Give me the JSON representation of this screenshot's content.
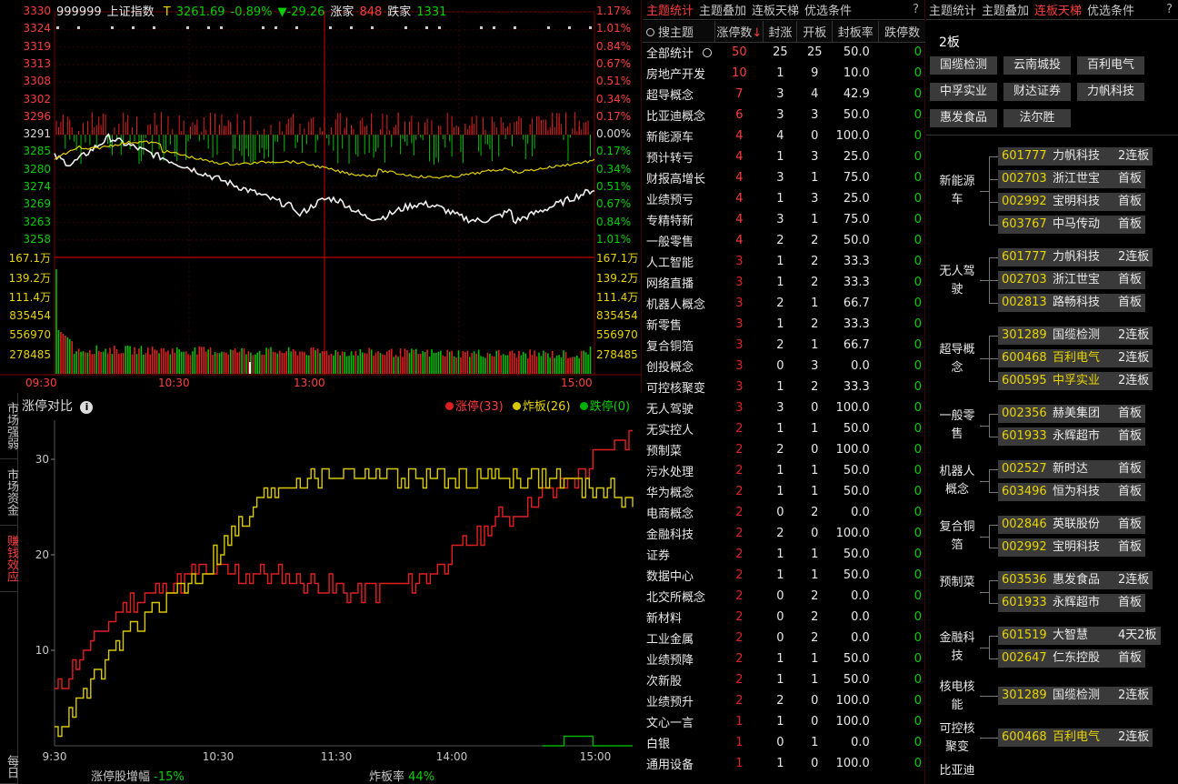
{
  "index": {
    "code": "999999",
    "name": "上证指数",
    "mark": "T",
    "price": "3261.69",
    "change_pct": "-0.89%",
    "change": "▼-29.26",
    "up_label": "涨家",
    "up_count": "848",
    "down_label": "跌家",
    "down_count": "1331"
  },
  "price_axis_left": [
    "3330",
    "3324",
    "3319",
    "3313",
    "3308",
    "3302",
    "3296",
    "3291",
    "3285",
    "3280",
    "3274",
    "3269",
    "3263",
    "3258"
  ],
  "price_axis_right": [
    "1.17%",
    "1.01%",
    "0.84%",
    "0.67%",
    "0.51%",
    "0.34%",
    "0.17%",
    "0.00%",
    "0.17%",
    "0.34%",
    "0.51%",
    "0.67%",
    "0.84%",
    "1.01%"
  ],
  "volume_axis": [
    "167.1万",
    "139.2万",
    "111.4万",
    "835454",
    "556970",
    "278485"
  ],
  "time_axis": [
    "09:30",
    "10:30",
    "13:00",
    "15:00"
  ],
  "side_tabs": [
    "市场强弱",
    "市场资金",
    "赚钱效应",
    "每日"
  ],
  "compare": {
    "title": "涨停对比",
    "legend": [
      {
        "label": "涨停(33)",
        "color": "#e02020"
      },
      {
        "label": "炸板(26)",
        "color": "#d8c800"
      },
      {
        "label": "跌停(0)",
        "color": "#00b000"
      }
    ],
    "y_ticks": [
      "30",
      "20",
      "10"
    ],
    "x_ticks": [
      "9:30",
      "10:30",
      "11:30",
      "14:00",
      "15:00"
    ],
    "footer_left_label": "涨停股增幅",
    "footer_left_value": "-15%",
    "footer_right_label": "炸板率",
    "footer_right_value": "44%"
  },
  "chart_data": {
    "type": "line",
    "title": "涨停对比",
    "xlabel": "",
    "ylabel": "",
    "x": [
      "9:30",
      "10:00",
      "10:30",
      "11:00",
      "11:30",
      "13:30",
      "14:00",
      "14:30",
      "15:00"
    ],
    "series": [
      {
        "name": "涨停(33)",
        "values": [
          6,
          15,
          18,
          18,
          16,
          17,
          23,
          27,
          33
        ]
      },
      {
        "name": "炸板(26)",
        "values": [
          1,
          12,
          18,
          27,
          29,
          28,
          28,
          28,
          26
        ]
      },
      {
        "name": "跌停(0)",
        "values": [
          0,
          0,
          0,
          0,
          0,
          0,
          0,
          1,
          0
        ]
      }
    ],
    "ylim": [
      0,
      33
    ],
    "legend": "top-right"
  },
  "theme_panel": {
    "tabs": [
      "主题统计",
      "主题叠加",
      "连板天梯",
      "优选条件"
    ],
    "active_tab": 0,
    "help": "?",
    "columns": [
      "搜主题",
      "涨停数",
      "封涨",
      "开板",
      "封板率",
      "跌停数"
    ],
    "rows": [
      {
        "name": "全部统计",
        "zt": "50",
        "fz": "25",
        "kb": "25",
        "rate": "50.0",
        "dt": "0"
      },
      {
        "name": "房地产开发",
        "zt": "10",
        "fz": "1",
        "kb": "9",
        "rate": "10.0",
        "dt": "0"
      },
      {
        "name": "超导概念",
        "zt": "7",
        "fz": "3",
        "kb": "4",
        "rate": "42.9",
        "dt": "0"
      },
      {
        "name": "比亚迪概念",
        "zt": "6",
        "fz": "3",
        "kb": "3",
        "rate": "50.0",
        "dt": "0"
      },
      {
        "name": "新能源车",
        "zt": "4",
        "fz": "4",
        "kb": "0",
        "rate": "100.0",
        "dt": "0"
      },
      {
        "name": "预计转亏",
        "zt": "4",
        "fz": "1",
        "kb": "3",
        "rate": "25.0",
        "dt": "0"
      },
      {
        "name": "财报高增长",
        "zt": "4",
        "fz": "3",
        "kb": "1",
        "rate": "75.0",
        "dt": "0"
      },
      {
        "name": "业绩预亏",
        "zt": "4",
        "fz": "1",
        "kb": "3",
        "rate": "25.0",
        "dt": "0"
      },
      {
        "name": "专精特新",
        "zt": "4",
        "fz": "3",
        "kb": "1",
        "rate": "75.0",
        "dt": "0"
      },
      {
        "name": "一般零售",
        "zt": "4",
        "fz": "2",
        "kb": "2",
        "rate": "50.0",
        "dt": "0"
      },
      {
        "name": "人工智能",
        "zt": "3",
        "fz": "1",
        "kb": "2",
        "rate": "33.3",
        "dt": "0"
      },
      {
        "name": "网络直播",
        "zt": "3",
        "fz": "1",
        "kb": "2",
        "rate": "33.3",
        "dt": "0"
      },
      {
        "name": "机器人概念",
        "zt": "3",
        "fz": "2",
        "kb": "1",
        "rate": "66.7",
        "dt": "0"
      },
      {
        "name": "新零售",
        "zt": "3",
        "fz": "1",
        "kb": "2",
        "rate": "33.3",
        "dt": "0"
      },
      {
        "name": "复合铜箔",
        "zt": "3",
        "fz": "2",
        "kb": "1",
        "rate": "66.7",
        "dt": "0"
      },
      {
        "name": "创投概念",
        "zt": "3",
        "fz": "0",
        "kb": "3",
        "rate": "0.0",
        "dt": "0"
      },
      {
        "name": "可控核聚变",
        "zt": "3",
        "fz": "1",
        "kb": "2",
        "rate": "33.3",
        "dt": "0"
      },
      {
        "name": "无人驾驶",
        "zt": "3",
        "fz": "3",
        "kb": "0",
        "rate": "100.0",
        "dt": "0"
      },
      {
        "name": "无实控人",
        "zt": "2",
        "fz": "1",
        "kb": "1",
        "rate": "50.0",
        "dt": "0"
      },
      {
        "name": "预制菜",
        "zt": "2",
        "fz": "2",
        "kb": "0",
        "rate": "100.0",
        "dt": "0"
      },
      {
        "name": "污水处理",
        "zt": "2",
        "fz": "1",
        "kb": "1",
        "rate": "50.0",
        "dt": "0"
      },
      {
        "name": "华为概念",
        "zt": "2",
        "fz": "1",
        "kb": "1",
        "rate": "50.0",
        "dt": "0"
      },
      {
        "name": "电商概念",
        "zt": "2",
        "fz": "0",
        "kb": "2",
        "rate": "0.0",
        "dt": "0"
      },
      {
        "name": "金融科技",
        "zt": "2",
        "fz": "2",
        "kb": "0",
        "rate": "100.0",
        "dt": "0"
      },
      {
        "name": "证券",
        "zt": "2",
        "fz": "1",
        "kb": "1",
        "rate": "50.0",
        "dt": "0"
      },
      {
        "name": "数据中心",
        "zt": "2",
        "fz": "1",
        "kb": "1",
        "rate": "50.0",
        "dt": "0"
      },
      {
        "name": "北交所概念",
        "zt": "2",
        "fz": "0",
        "kb": "2",
        "rate": "0.0",
        "dt": "0"
      },
      {
        "name": "新材料",
        "zt": "2",
        "fz": "0",
        "kb": "2",
        "rate": "0.0",
        "dt": "0"
      },
      {
        "name": "工业金属",
        "zt": "2",
        "fz": "0",
        "kb": "2",
        "rate": "0.0",
        "dt": "0"
      },
      {
        "name": "业绩预降",
        "zt": "2",
        "fz": "1",
        "kb": "1",
        "rate": "50.0",
        "dt": "0"
      },
      {
        "name": "次新股",
        "zt": "2",
        "fz": "1",
        "kb": "1",
        "rate": "50.0",
        "dt": "0"
      },
      {
        "name": "业绩预升",
        "zt": "2",
        "fz": "2",
        "kb": "0",
        "rate": "100.0",
        "dt": "0"
      },
      {
        "name": "文心一言",
        "zt": "1",
        "fz": "1",
        "kb": "0",
        "rate": "100.0",
        "dt": "0"
      },
      {
        "name": "白银",
        "zt": "1",
        "fz": "0",
        "kb": "1",
        "rate": "0.0",
        "dt": "0"
      },
      {
        "name": "通用设备",
        "zt": "1",
        "fz": "1",
        "kb": "0",
        "rate": "100.0",
        "dt": "0"
      }
    ]
  },
  "ladder_panel": {
    "tabs": [
      "主题统计",
      "主题叠加",
      "连板天梯",
      "优选条件"
    ],
    "active_tab": 2,
    "help": "?",
    "board_title": "2板",
    "chips": [
      "国缆检测",
      "云南城投",
      "百利电气",
      "中孚实业",
      "财达证券",
      "力帆科技",
      "惠发食品",
      "法尔胜"
    ],
    "groups": [
      {
        "label": "新能源车",
        "stocks": [
          {
            "code": "601777",
            "name": "力帆科技",
            "tag": "2连板"
          },
          {
            "code": "002703",
            "name": "浙江世宝",
            "tag": "首板"
          },
          {
            "code": "002992",
            "name": "宝明科技",
            "tag": "首板"
          },
          {
            "code": "603767",
            "name": "中马传动",
            "tag": "首板"
          }
        ]
      },
      {
        "label": "无人驾驶",
        "stocks": [
          {
            "code": "601777",
            "name": "力帆科技",
            "tag": "2连板"
          },
          {
            "code": "002703",
            "name": "浙江世宝",
            "tag": "首板"
          },
          {
            "code": "002813",
            "name": "路畅科技",
            "tag": "首板"
          }
        ]
      },
      {
        "label": "超导概念",
        "stocks": [
          {
            "code": "301289",
            "name": "国缆检测",
            "tag": "2连板"
          },
          {
            "code": "600468",
            "name": "百利电气",
            "tag": "2连板",
            "hl": true
          },
          {
            "code": "600595",
            "name": "中孚实业",
            "tag": "2连板",
            "hl": true
          }
        ]
      },
      {
        "label": "一般零售",
        "stocks": [
          {
            "code": "002356",
            "name": "赫美集团",
            "tag": "首板"
          },
          {
            "code": "601933",
            "name": "永辉超市",
            "tag": "首板"
          }
        ]
      },
      {
        "label": "机器人概念",
        "stocks": [
          {
            "code": "002527",
            "name": "新时达",
            "tag": "首板"
          },
          {
            "code": "603496",
            "name": "恒为科技",
            "tag": "首板"
          }
        ]
      },
      {
        "label": "复合铜箔",
        "stocks": [
          {
            "code": "002846",
            "name": "英联股份",
            "tag": "首板"
          },
          {
            "code": "002992",
            "name": "宝明科技",
            "tag": "首板"
          }
        ]
      },
      {
        "label": "预制菜",
        "stocks": [
          {
            "code": "603536",
            "name": "惠发食品",
            "tag": "2连板"
          },
          {
            "code": "601933",
            "name": "永辉超市",
            "tag": "首板"
          }
        ]
      },
      {
        "label": "金融科技",
        "stocks": [
          {
            "code": "601519",
            "name": "大智慧",
            "tag": "4天2板"
          },
          {
            "code": "002647",
            "name": "仁东控股",
            "tag": "首板"
          }
        ]
      },
      {
        "label": "核电核能",
        "stocks": [
          {
            "code": "301289",
            "name": "国缆检测",
            "tag": "2连板"
          }
        ]
      },
      {
        "label": "可控核聚变",
        "stocks": [
          {
            "code": "600468",
            "name": "百利电气",
            "tag": "2连板",
            "hl": true
          }
        ]
      },
      {
        "label": "比亚迪",
        "stocks": []
      }
    ]
  },
  "colors": {
    "up": "#ff3c3c",
    "down": "#00d000",
    "accent": "#e8d400",
    "grid": "#6a0000"
  }
}
